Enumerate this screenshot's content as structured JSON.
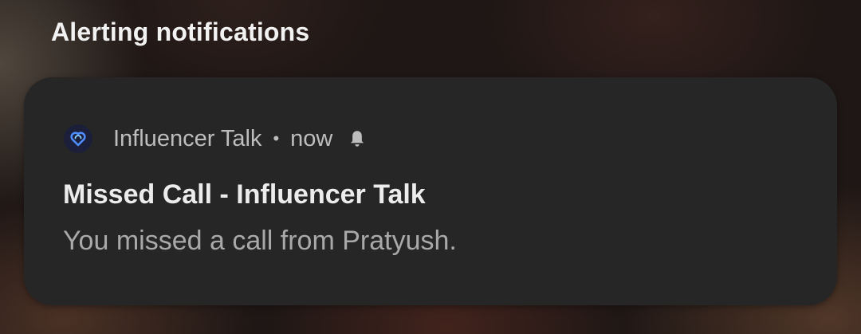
{
  "section": {
    "title": "Alerting notifications"
  },
  "notification": {
    "app_name": "Influencer Talk",
    "separator": "•",
    "time": "now",
    "title": "Missed Call - Influencer Talk",
    "body": "You missed a call from Pratyush.",
    "app_icon": "influencer-talk-logo-icon",
    "alert_icon": "bell-icon"
  },
  "colors": {
    "card_background": "#262626",
    "title_text": "#ececec",
    "secondary_text": "#bdbdbd",
    "logo_background": "#1b1f3a",
    "logo_accent": "#4f8dff"
  }
}
